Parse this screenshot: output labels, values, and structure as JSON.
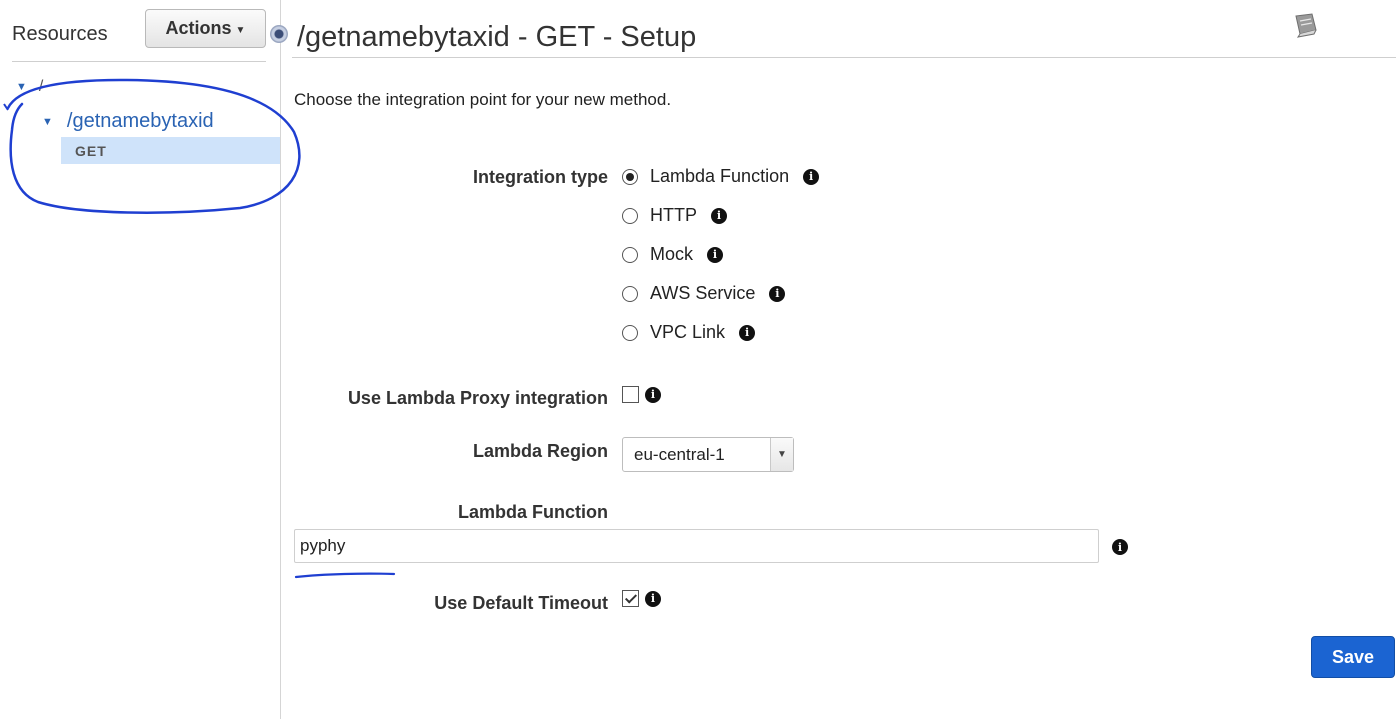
{
  "sidebar": {
    "title": "Resources",
    "actions_label": "Actions",
    "tree": {
      "root": "/",
      "child": "/getnamebytaxid",
      "method": "GET"
    }
  },
  "main": {
    "title": "/getnamebytaxid - GET - Setup",
    "intro": "Choose the integration point for your new method.",
    "integration_type_label": "Integration type",
    "integration_types": [
      {
        "label": "Lambda Function",
        "selected": true
      },
      {
        "label": "HTTP",
        "selected": false
      },
      {
        "label": "Mock",
        "selected": false
      },
      {
        "label": "AWS Service",
        "selected": false
      },
      {
        "label": "VPC Link",
        "selected": false
      }
    ],
    "proxy_label": "Use Lambda Proxy integration",
    "proxy_checked": false,
    "region_label": "Lambda Region",
    "region_value": "eu-central-1",
    "function_label": "Lambda Function",
    "function_value": "pyphy",
    "timeout_label": "Use Default Timeout",
    "timeout_checked": true,
    "save_label": "Save"
  },
  "colors": {
    "link": "#2a63b3",
    "selected_row": "#cfe3fa",
    "primary_button": "#1b64d2",
    "annotation_ink": "#1f3fd1"
  },
  "icons": [
    "caret-down-icon",
    "info-icon",
    "book-icon",
    "collapse-handle-icon"
  ]
}
